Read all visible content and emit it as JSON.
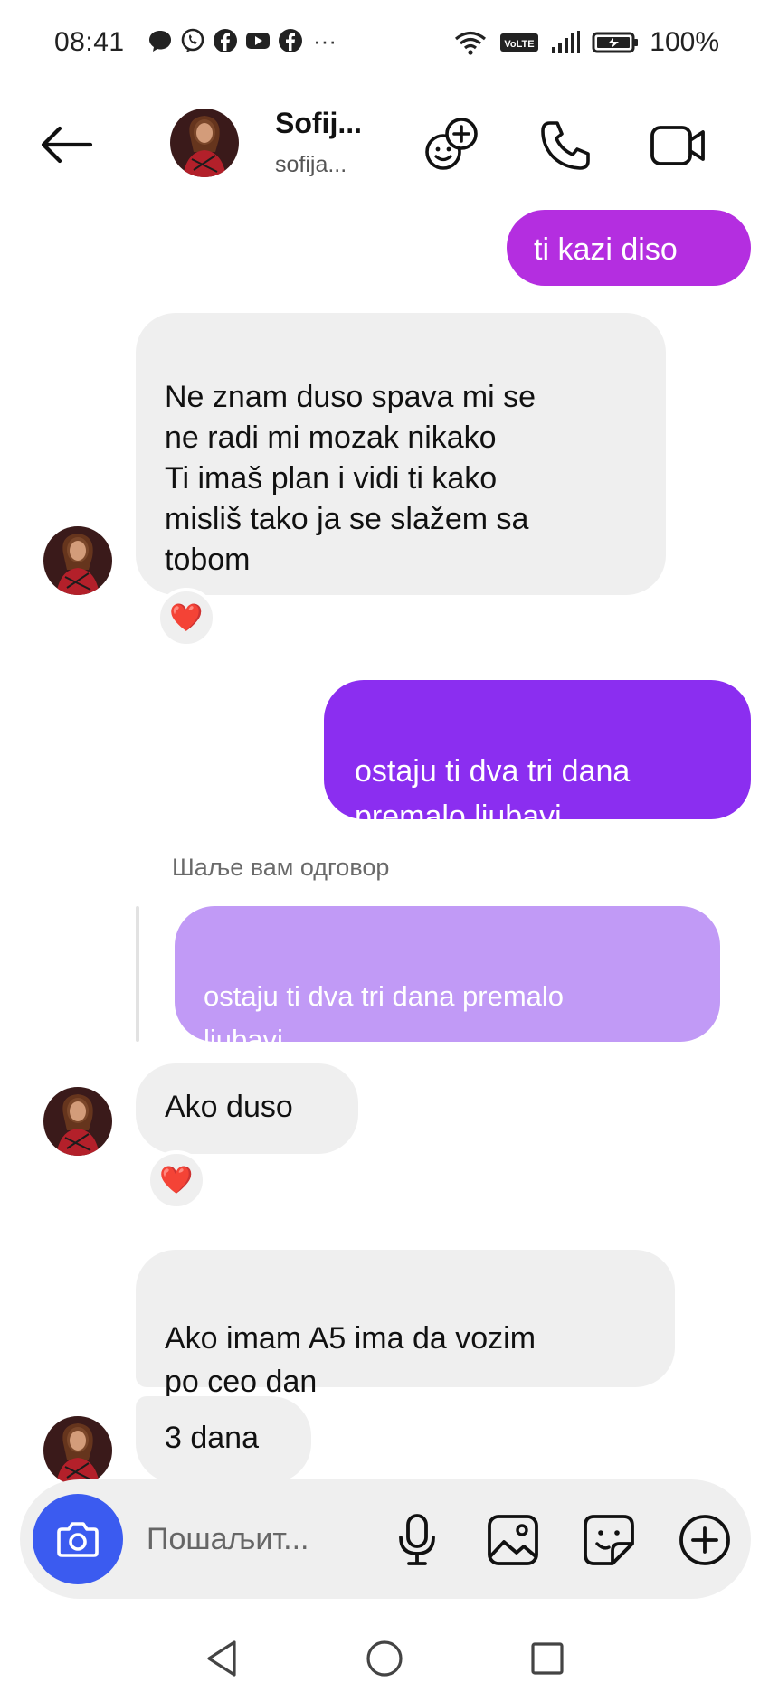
{
  "status_bar": {
    "time": "08:41",
    "battery": "100%",
    "network_badge": "VoLTE",
    "notification_icons": [
      "chat-bubble-icon",
      "viber-icon",
      "facebook-icon",
      "youtube-icon",
      "facebook-icon"
    ],
    "overflow": "···"
  },
  "header": {
    "name": "Sofij...",
    "username": "sofija...",
    "icons": [
      "back-arrow-icon",
      "add-emoji-effects-icon",
      "phone-icon",
      "video-camera-icon"
    ]
  },
  "messages": [
    {
      "id": "m1",
      "direction": "outgoing",
      "text": "ti kazi diso",
      "color": "#b42ee0"
    },
    {
      "id": "m2",
      "direction": "incoming",
      "text": "Ne znam duso spava mi se\nne radi mi mozak nikako\nTi imaš plan i vidi ti kako\nmisliš tako ja se slažem sa\ntobom",
      "reaction": "❤️"
    },
    {
      "id": "m3",
      "direction": "outgoing",
      "text": "ostaju ti dva tri dana\npremalo ljubavi",
      "color": "#8b2ef0"
    },
    {
      "id": "m4",
      "direction": "incoming",
      "reply_label": "Шаље вам одговор",
      "quoted": "ostaju ti dva tri dana premalo\nljubavi",
      "text": "Ako duso",
      "reaction": "❤️"
    },
    {
      "id": "m5",
      "direction": "incoming",
      "text": "Ako imam A5 ima da vozim\npo ceo dan"
    },
    {
      "id": "m6",
      "direction": "incoming",
      "text": "3 dana"
    }
  ],
  "composer": {
    "placeholder": "Пошаљит...",
    "icons": [
      "camera-icon",
      "microphone-icon",
      "gallery-icon",
      "sticker-icon",
      "plus-icon"
    ]
  },
  "colors": {
    "outgoing_pink": "#b42ee0",
    "outgoing_purple": "#8b2ef0",
    "reply_quote": "#c19af6",
    "camera_button": "#3b5bf0",
    "incoming_bubble": "#efefef"
  }
}
